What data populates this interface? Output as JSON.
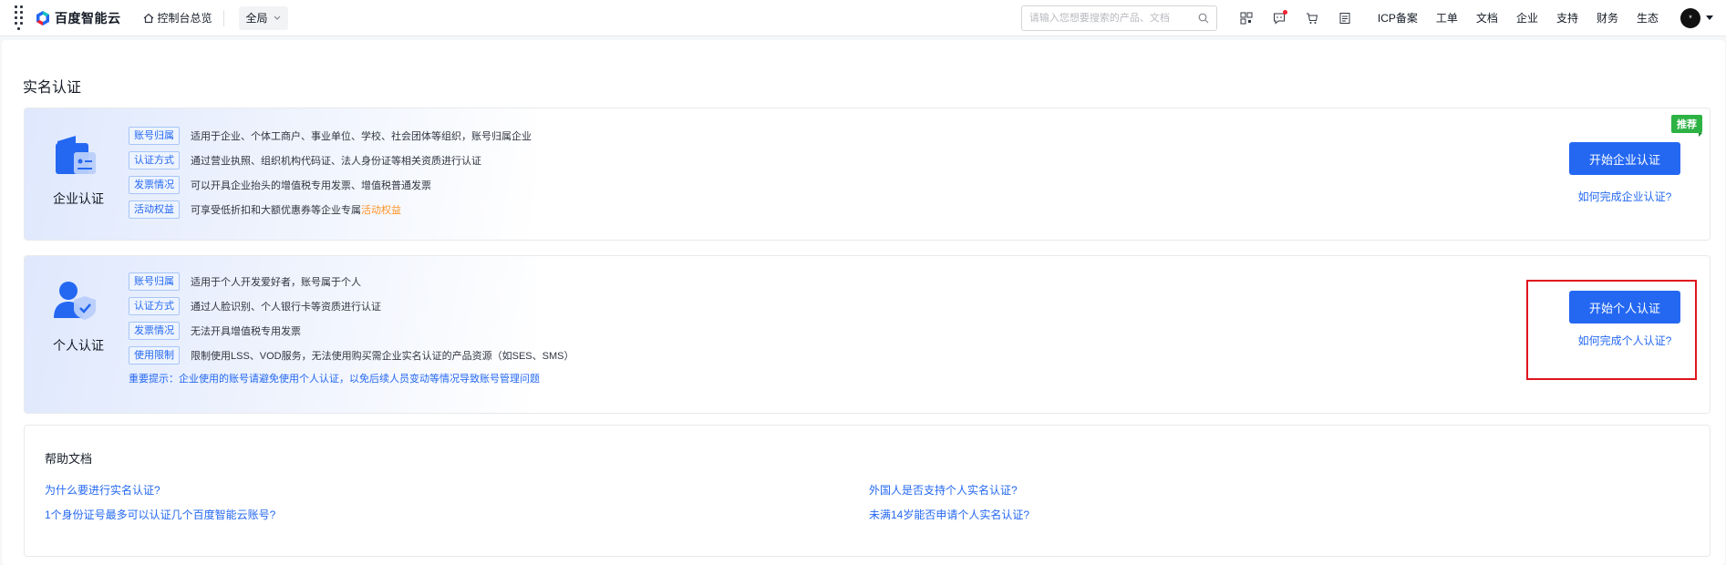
{
  "header": {
    "logo_text": "百度智能云",
    "home_label": "控制台总览",
    "region_label": "全局",
    "search_placeholder": "请输入您想要搜索的产品、文档",
    "tool_icons": [
      "qrcode-icon",
      "message-icon",
      "cart-icon",
      "document-icon"
    ],
    "links": [
      "ICP备案",
      "工单",
      "文档",
      "企业",
      "支持",
      "财务",
      "生态"
    ],
    "avatar_char": "*"
  },
  "page": {
    "title": "实名认证"
  },
  "enterprise": {
    "label": "企业认证",
    "badge": "推荐",
    "rows": [
      {
        "tag": "账号归属",
        "text": "适用于企业、个体工商户、事业单位、学校、社会团体等组织，账号归属企业"
      },
      {
        "tag": "认证方式",
        "text": "通过营业执照、组织机构代码证、法人身份证等相关资质进行认证"
      },
      {
        "tag": "发票情况",
        "text": "可以开具企业抬头的增值税专用发票、增值税普通发票"
      },
      {
        "tag": "活动权益",
        "text": "可享受低折扣和大额优惠券等企业专属",
        "highlight": "活动权益"
      }
    ],
    "button": "开始企业认证",
    "help": "如何完成企业认证?"
  },
  "personal": {
    "label": "个人认证",
    "rows": [
      {
        "tag": "账号归属",
        "text": "适用于个人开发爱好者，账号属于个人"
      },
      {
        "tag": "认证方式",
        "text": "通过人脸识别、个人银行卡等资质进行认证"
      },
      {
        "tag": "发票情况",
        "text": "无法开具增值税专用发票"
      },
      {
        "tag": "使用限制",
        "text": "限制使用LSS、VOD服务，无法使用购买需企业实名认证的产品资源（如SES、SMS）"
      }
    ],
    "tip": "重要提示：企业使用的账号请避免使用个人认证，以免后续人员变动等情况导致账号管理问题",
    "button": "开始个人认证",
    "help": "如何完成个人认证?"
  },
  "help_docs": {
    "title": "帮助文档",
    "links": [
      "为什么要进行实名认证?",
      "1个身份证号最多可以认证几个百度智能云账号?",
      "外国人是否支持个人实名认证?",
      "未满14岁能否申请个人实名认证?"
    ]
  },
  "colors": {
    "primary": "#2468f2",
    "badge_green": "#2db244",
    "highlight_red": "#e0141d",
    "accent_orange": "#ff9326"
  }
}
